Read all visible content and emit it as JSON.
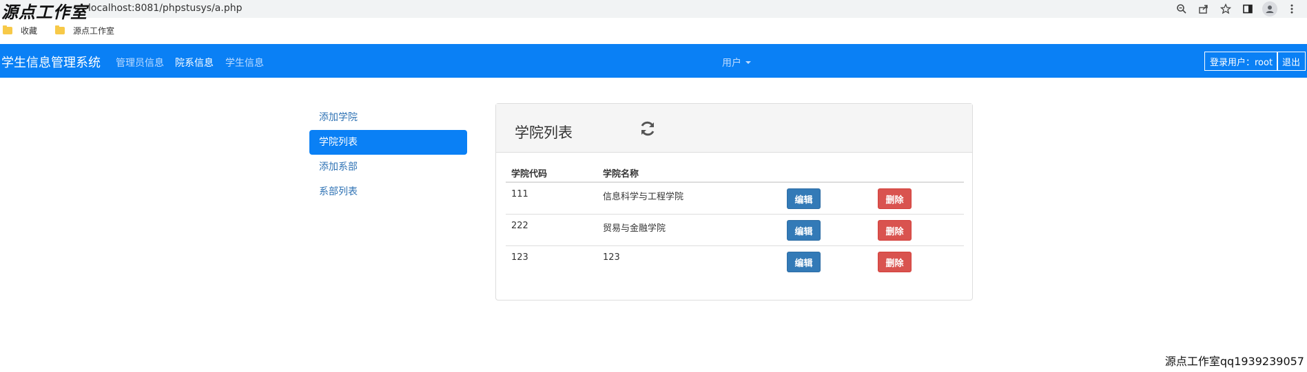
{
  "browser": {
    "watermark": "源点工作室",
    "url": "localhost:8081/phpstusys/a.php",
    "bookmarks": [
      {
        "label": "收藏"
      },
      {
        "label": "源点工作室"
      }
    ]
  },
  "navbar": {
    "brand": "学生信息管理系统",
    "links": {
      "admin": "管理员信息",
      "college": "院系信息",
      "student": "学生信息"
    },
    "user_menu": "用户",
    "login_user": "登录用户：root",
    "logout": "退出",
    "color": "#0a80f5"
  },
  "sidebar": {
    "items": [
      {
        "label": "添加学院",
        "active": false
      },
      {
        "label": "学院列表",
        "active": true
      },
      {
        "label": "添加系部",
        "active": false
      },
      {
        "label": "系部列表",
        "active": false
      }
    ]
  },
  "panel": {
    "title": "学院列表",
    "refresh_icon": "refresh-icon",
    "columns": [
      "学院代码",
      "学院名称"
    ],
    "rows": [
      {
        "code": "111",
        "name": "信息科学与工程学院",
        "edit": "编辑",
        "delete": "删除"
      },
      {
        "code": "222",
        "name": "贸易与金融学院",
        "edit": "编辑",
        "delete": "删除"
      },
      {
        "code": "123",
        "name": "123",
        "edit": "编辑",
        "delete": "删除"
      }
    ]
  },
  "footer_watermark": "源点工作室qq1939239057"
}
